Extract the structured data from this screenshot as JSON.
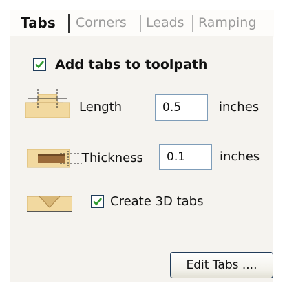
{
  "tabs": [
    {
      "label": "Tabs",
      "active": true
    },
    {
      "label": "Corners",
      "active": false
    },
    {
      "label": "Leads",
      "active": false
    },
    {
      "label": "Ramping",
      "active": false
    }
  ],
  "panel": {
    "add_tabs": {
      "label": "Add tabs to toolpath",
      "checked": true
    },
    "length": {
      "label": "Length",
      "value": "0.5",
      "unit": "inches",
      "icon": "tab-length-icon"
    },
    "thickness": {
      "label": "Thickness",
      "value": "0.1",
      "unit": "inches",
      "icon": "tab-thickness-icon"
    },
    "create_3d": {
      "label": "Create 3D tabs",
      "checked": true,
      "icon": "3d-tab-icon"
    },
    "edit_button": {
      "label": "Edit Tabs ...."
    }
  },
  "colors": {
    "panel_bg": "#f5f3ef",
    "wood": "#f2d9a0",
    "wood_dark": "#9c6b3a",
    "check": "#2f9a2f"
  }
}
